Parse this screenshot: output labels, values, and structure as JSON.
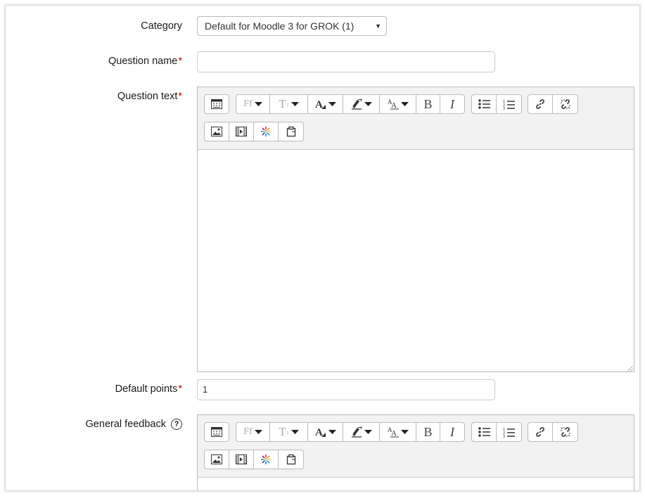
{
  "form": {
    "category": {
      "label": "Category",
      "value": "Default for Moodle 3 for GROK (1)"
    },
    "question_name": {
      "label": "Question name",
      "required_mark": "*",
      "value": ""
    },
    "question_text": {
      "label": "Question text",
      "required_mark": "*"
    },
    "default_points": {
      "label": "Default points",
      "required_mark": "*",
      "value": "1"
    },
    "general_feedback": {
      "label": "General feedback",
      "help_icon": "?"
    }
  },
  "toolbar": {
    "font_family_glyph": "Ff",
    "font_size_glyph": "T",
    "bold_glyph": "B",
    "italic_glyph": "I",
    "icons": [
      "toolbar-toggle-icon",
      "font-family-icon",
      "font-size-icon",
      "font-color-icon",
      "background-color-icon",
      "styles-icon",
      "bold-icon",
      "italic-icon",
      "unordered-list-icon",
      "ordered-list-icon",
      "link-icon",
      "unlink-icon",
      "image-icon",
      "media-icon",
      "recordrtc-icon",
      "paste-icon"
    ]
  },
  "colors": {
    "required": "#cc0000",
    "toolbar_bg": "#f2f2f2",
    "border": "#bbbbbb"
  }
}
